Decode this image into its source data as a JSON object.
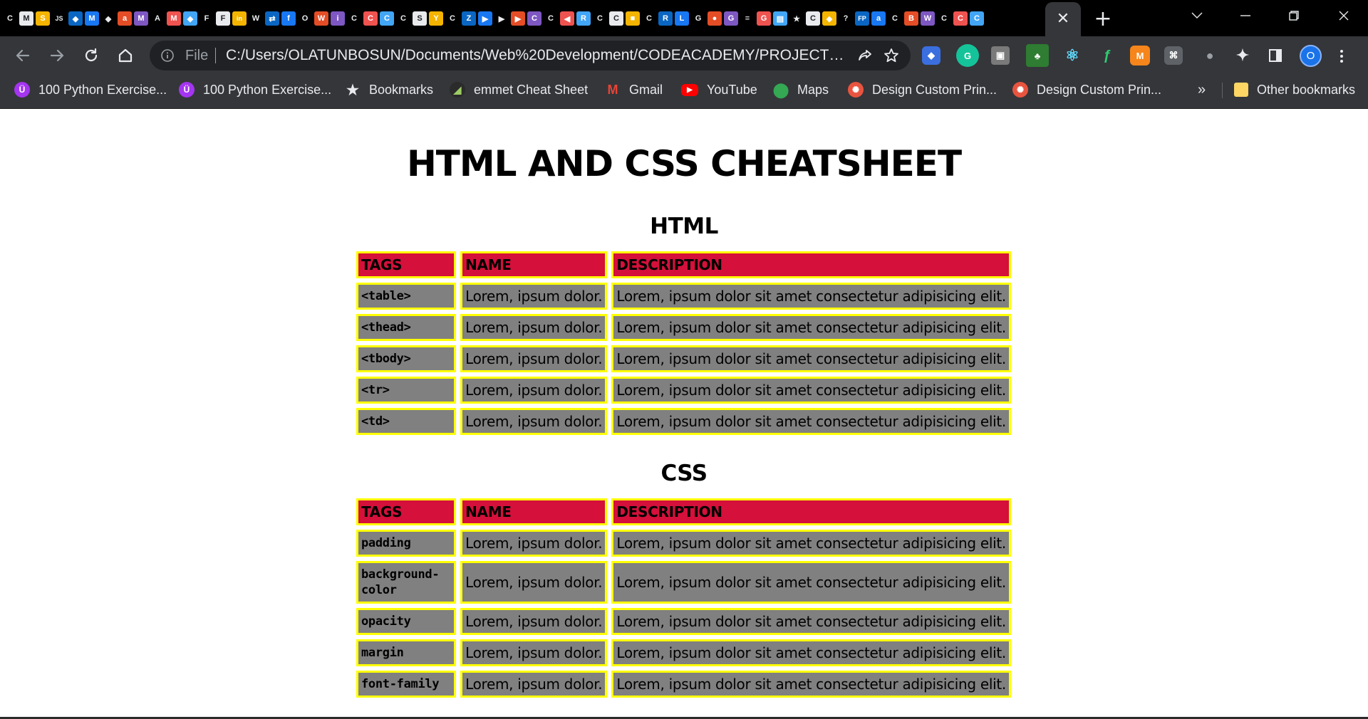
{
  "browser": {
    "tabs": {
      "favicons": [
        "c-logo",
        "m-logo",
        "stackoverflow",
        "js",
        "generic",
        "m-logo",
        "generic",
        "a",
        "m-logo",
        "azure",
        "m-logo",
        "generic",
        "figma",
        "figma",
        "linkedin",
        "w",
        "arrows",
        "facebook",
        "o",
        "w",
        "info",
        "c",
        "c",
        "c",
        "c",
        "s",
        "y",
        "c",
        "z",
        "play",
        "play",
        "play",
        "c",
        "c",
        "left",
        "r",
        "c",
        "c",
        "green",
        "c",
        "r",
        "l",
        "g",
        "map",
        "g",
        "list",
        "g",
        "note",
        "star",
        "c",
        "generic",
        "help",
        "fp",
        "a",
        "c",
        "b",
        "w",
        "c",
        "c",
        "c"
      ],
      "active_tab_close": "✕",
      "new_tab": "+"
    },
    "window_controls": [
      "minimize-icon",
      "maximize-icon",
      "close-icon"
    ],
    "toolbar": {
      "scheme": "File",
      "url": "C:/Users/OLATUNBOSUN/Documents/Web%20Development/CODEACADEMY/PROJECTS/P...",
      "profile_initial": "O"
    },
    "bookmarks": [
      {
        "label": "100 Python Exercise...",
        "icon": "udemy-icon",
        "color": "#a435f0"
      },
      {
        "label": "100 Python Exercise...",
        "icon": "udemy-icon",
        "color": "#a435f0"
      },
      {
        "label": "Bookmarks",
        "icon": "star-icon",
        "color": "#e8eaed"
      },
      {
        "label": "emmet Cheat Sheet",
        "icon": "emmet-icon",
        "color": "#2b2b2b"
      },
      {
        "label": "Gmail",
        "icon": "gmail-icon",
        "color": "#ea4335"
      },
      {
        "label": "YouTube",
        "icon": "youtube-icon",
        "color": "#ff0000"
      },
      {
        "label": "Maps",
        "icon": "maps-icon",
        "color": "#34a853"
      },
      {
        "label": "Design Custom Prin...",
        "icon": "printful-icon",
        "color": "#e8543f"
      },
      {
        "label": "Design Custom Prin...",
        "icon": "printful-icon",
        "color": "#e8543f"
      }
    ],
    "bookmarks_more": "»",
    "other_bookmarks": "Other bookmarks"
  },
  "page": {
    "title": "HTML AND CSS CHEATSHEET",
    "html_section": {
      "heading": "HTML",
      "headers": [
        "TAGS",
        "NAME",
        "DESCRIPTION"
      ],
      "rows": [
        {
          "tag": "<table>",
          "name": "Lorem, ipsum dolor.",
          "description": "Lorem, ipsum dolor sit amet consectetur adipisicing elit."
        },
        {
          "tag": "<thead>",
          "name": "Lorem, ipsum dolor.",
          "description": "Lorem, ipsum dolor sit amet consectetur adipisicing elit."
        },
        {
          "tag": "<tbody>",
          "name": "Lorem, ipsum dolor.",
          "description": "Lorem, ipsum dolor sit amet consectetur adipisicing elit."
        },
        {
          "tag": "<tr>",
          "name": "Lorem, ipsum dolor.",
          "description": "Lorem, ipsum dolor sit amet consectetur adipisicing elit."
        },
        {
          "tag": "<td>",
          "name": "Lorem, ipsum dolor.",
          "description": "Lorem, ipsum dolor sit amet consectetur adipisicing elit."
        }
      ]
    },
    "css_section": {
      "heading": "CSS",
      "headers": [
        "TAGS",
        "NAME",
        "DESCRIPTION"
      ],
      "rows": [
        {
          "tag": "padding",
          "name": "Lorem, ipsum dolor.",
          "description": "Lorem, ipsum dolor sit amet consectetur adipisicing elit."
        },
        {
          "tag": "background-color",
          "name": "Lorem, ipsum dolor.",
          "description": "Lorem, ipsum dolor sit amet consectetur adipisicing elit."
        },
        {
          "tag": "opacity",
          "name": "Lorem, ipsum dolor.",
          "description": "Lorem, ipsum dolor sit amet consectetur adipisicing elit."
        },
        {
          "tag": "margin",
          "name": "Lorem, ipsum dolor.",
          "description": "Lorem, ipsum dolor sit amet consectetur adipisicing elit."
        },
        {
          "tag": "font-family",
          "name": "Lorem, ipsum dolor.",
          "description": "Lorem, ipsum dolor sit amet consectetur adipisicing elit."
        }
      ]
    },
    "colors": {
      "header_bg": "#d4103b",
      "cell_bg": "#808080",
      "cell_border": "#ffff00"
    }
  }
}
